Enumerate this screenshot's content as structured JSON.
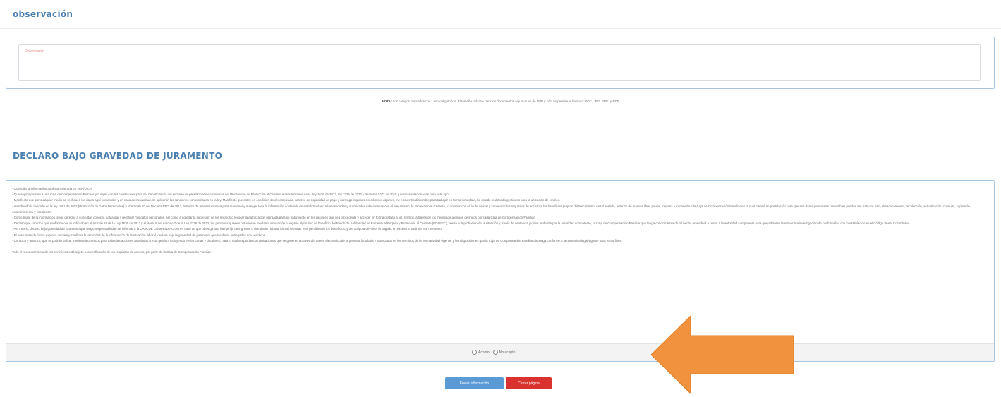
{
  "observacion": {
    "title": "observación",
    "textarea_placeholder": "Observación"
  },
  "note": {
    "strong": "NOTA:",
    "text": " Los campos marcados con * son obligatorios. El tamaño máximo para los documentos adjuntos es de 5MB y sólo se permite el formato: DOC, JPG, PNG, y PDF"
  },
  "declaracion": {
    "title": "DECLARO BAJO GRAVEDAD DE JURAMENTO",
    "paragraphs": [
      "· Que toda la información aquí suministrada es VERÍDICA.",
      "· Que soy/no postulo a una Caja de Compensación Familiar y cumplo con las condiciones para ser beneficiario/a del subsidio de prestaciones económicas del Mecanismo de Protección al Cesante en los términos de la Ley 1636 de 2013, ley 2225 de 2022 y decretos 1072 de 2015 y normas relacionadas para este tipo.",
      "· Manifiesto que por cualquier medio se verifiquen los datos aquí contenidos y en caso de inexactitud, se aplicarán las sanciones contempladas en la ley. Manifiesto que estoy en condición de desempleado, carezco de capacidad de pago y no tengo ingresos económicos algunos, me encuentro disponible para trabajar en forma inmediata, he estado realizando gestiones para la ubicación de empleo.",
      "· Atendiendo lo indicado en la ley 1581 de 2012 (Protección de Datos Personales) y el artículo 8° del Decreto 1377 de 2013, autorizo de manera expresa para mantener y manejar toda la información contenida en este formulario a las entidades y autoridades relacionadas con el Mecanismo de Protección al Cesante, lo anterior con el fin de validar y supervisar los requisitos de acceso a los beneficios propios del Mecanismo, en tal sentido, autorizo de manera libre, previa, expresa e informada a la Caja de Compensación Familiar en la cual tramité mi postulación para que mis datos personales o sensibles puedan ser tratados para almacenamiento, recolección, actualización, consulta, supresión, compartimiento y circulación.",
      "· Como titular de la información tengo derecho a consultar, conocer, actualizar y rectificar mis datos personales, así como a solicitar la supresión de los mismos o revocar la autorización otorgada para su tratamiento en los casos en que sea procedente y acceder en forma gratuita a los mismos, a través de los medios de atención definidos por cada Caja de Compensación Familiar.",
      "· Declaro que conozco que conforme con lo indicado en el artículo 15 de la Ley 1636 de 2013 y el literal 5 del Artículo 7 de la Ley 2225 de 2022, los personas quienes obtuviesen mediante simulación o engaño algún tipo de beneficio del Fondo de Solidaridad de Fomento al Empleo y Protección al Cesante (FOSFEC), previa comprobación de la situación y través de sentencia judicial proferida por la autoridad competente, la Caja de Compensación Familiar que tenga conocimiento de tal hecho procederá a poner a la autoridad competente para que adelante la respectiva investigación de conformidad con lo establecido en el Código Penal Colombiano.",
      "· Así mismo, declaro bajo gravedad de juramento que tengo responsabilidad de informar a la CAJA DE COMPENSACIÓN en caso de que obtenga una fuente fija de ingresos o vinculación laboral formal mientras esté percibiendo los beneficios, y me obligo a devolver lo pagado en exceso a partir de ese momento.",
      "· El postulante de forma expresa declara y confirma la veracidad de la información de la situación laboral, declara bajo la gravedad de juramento que los datos entregados son verídicos.",
      "· Conozco y autorizo, que se podrán utilizar medios electrónicos para todas las acciones asociadas a esta gestión, incluyendo enviar cartas y circulares, para lo cual acepto las comunicaciones que se generen a través del correo electrónico de la persona facultada y autorizada, en los términos de la normatividad vigente, y las disposiciones que la Caja de Compensación Familiar disponga conforme a la normativa legal vigente para estos fines.",
      "Todo el reconocimiento de los beneficios está sujeto a la verificación de los requisitos de acceso, por parte de la Caja de Compensación Familiar."
    ],
    "radio_accept": "Acepto",
    "radio_reject": "No acepto"
  },
  "buttons": {
    "send": "Enviar información",
    "close": "Cerrar página"
  },
  "colors": {
    "accent": "#4a7fb0",
    "send_button": "#5b9bd5",
    "close_button": "#d9322f",
    "arrow": "#f0923e"
  }
}
